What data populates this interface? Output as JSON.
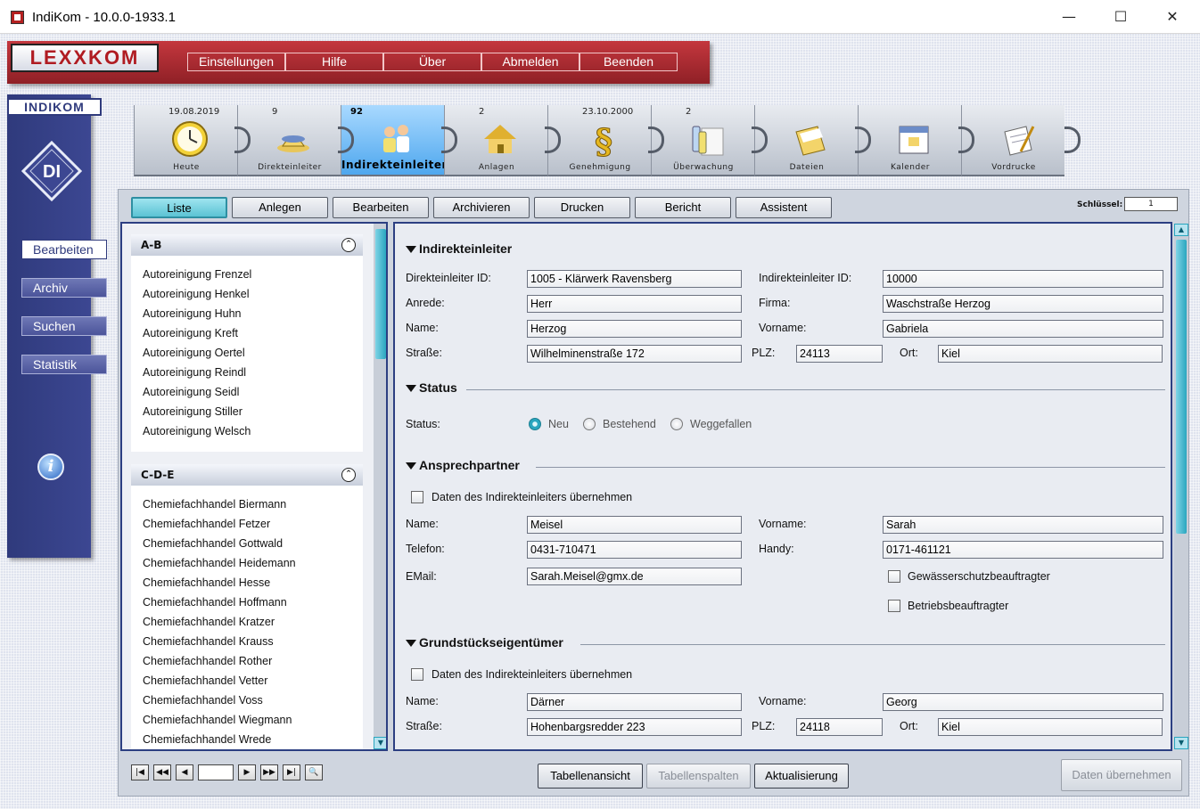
{
  "window": {
    "title": "IndiKom  -  10.0.0-1933.1",
    "minimize": "—",
    "maximize": "☐",
    "close": "✕"
  },
  "banner": {
    "logo": "LEXXKOM",
    "menu": [
      "Einstellungen",
      "Hilfe",
      "Über",
      "Abmelden",
      "Beenden"
    ]
  },
  "sidebar": {
    "logo": "INDIKOM",
    "monogram": "DI",
    "items": [
      "Bearbeiten",
      "Archiv",
      "Suchen",
      "Statistik"
    ],
    "active": "Bearbeiten",
    "info_icon": "i"
  },
  "modules": [
    {
      "top": "19.08.2019",
      "label": "Heute",
      "icon": "clock-icon"
    },
    {
      "top": "9",
      "label": "Direkteinleiter",
      "icon": "hats-icon"
    },
    {
      "top": "92",
      "label": "Indirekteinleiter",
      "icon": "people-icon",
      "active": true
    },
    {
      "top": "2",
      "label": "Anlagen",
      "icon": "house-icon"
    },
    {
      "top": "23.10.2000",
      "label": "Genehmigung",
      "icon": "paragraph-icon"
    },
    {
      "top": "2",
      "label": "Überwachung",
      "icon": "bottles-icon"
    },
    {
      "top": "",
      "label": "Dateien",
      "icon": "folder-icon"
    },
    {
      "top": "",
      "label": "Kalender",
      "icon": "calendar-icon"
    },
    {
      "top": "",
      "label": "Vordrucke",
      "icon": "forms-icon"
    }
  ],
  "toolbar": {
    "buttons": [
      "Liste",
      "Anlegen",
      "Bearbeiten",
      "Archivieren",
      "Drucken",
      "Bericht",
      "Assistent"
    ],
    "active": "Liste",
    "key_label": "Schlüssel:",
    "key_value": "1"
  },
  "list": {
    "groups": [
      {
        "name": "A-B",
        "items": [
          "Autoreinigung Frenzel",
          "Autoreinigung Henkel",
          "Autoreinigung Huhn",
          "Autoreinigung Kreft",
          "Autoreinigung Oertel",
          "Autoreinigung Reindl",
          "Autoreinigung Seidl",
          "Autoreinigung Stiller",
          "Autoreinigung Welsch"
        ]
      },
      {
        "name": "C-D-E",
        "items": [
          "Chemiefachhandel Biermann",
          "Chemiefachhandel Fetzer",
          "Chemiefachhandel Gottwald",
          "Chemiefachhandel Heidemann",
          "Chemiefachhandel Hesse",
          "Chemiefachhandel Hoffmann",
          "Chemiefachhandel Kratzer",
          "Chemiefachhandel Krauss",
          "Chemiefachhandel Rother",
          "Chemiefachhandel Vetter",
          "Chemiefachhandel Voss",
          "Chemiefachhandel Wiegmann",
          "Chemiefachhandel Wrede"
        ]
      }
    ],
    "collapse_icon": "⌃"
  },
  "pager": {
    "page_value": "",
    "search_icon": "🔍"
  },
  "bottom_buttons": {
    "table_view": "Tabellenansicht",
    "table_columns": "Tabellenspalten",
    "refresh": "Aktualisierung",
    "apply": "Daten übernehmen"
  },
  "form": {
    "indirekteinleiter": {
      "title": "Indirekteinleiter",
      "direkt_id_label": "Direkteinleiter ID:",
      "direkt_id": "1005 - Klärwerk Ravensberg",
      "indirekt_id_label": "Indirekteinleiter ID:",
      "indirekt_id": "10000",
      "anrede_label": "Anrede:",
      "anrede": "Herr",
      "firma_label": "Firma:",
      "firma": "Waschstraße Herzog",
      "name_label": "Name:",
      "name": "Herzog",
      "vorname_label": "Vorname:",
      "vorname": "Gabriela",
      "strasse_label": "Straße:",
      "strasse": "Wilhelminenstraße 172",
      "plz_label": "PLZ:",
      "plz": "24113",
      "ort_label": "Ort:",
      "ort": "Kiel"
    },
    "status": {
      "title": "Status",
      "label": "Status:",
      "options": [
        "Neu",
        "Bestehend",
        "Weggefallen"
      ],
      "selected": "Neu"
    },
    "ansprechpartner": {
      "title": "Ansprechpartner",
      "copy_label": "Daten des Indirekteinleiters übernehmen",
      "name_label": "Name:",
      "name": "Meisel",
      "vorname_label": "Vorname:",
      "vorname": "Sarah",
      "telefon_label": "Telefon:",
      "telefon": "0431-710471",
      "handy_label": "Handy:",
      "handy": "0171-461121",
      "email_label": "EMail:",
      "email": "Sarah.Meisel@gmx.de",
      "gewaesser_label": "Gewässerschutzbeauftragter",
      "betrieb_label": "Betriebsbeauftragter"
    },
    "eigentuemer": {
      "title": "Grundstückseigentümer",
      "copy_label": "Daten des Indirekteinleiters übernehmen",
      "name_label": "Name:",
      "name": "Därner",
      "vorname_label": "Vorname:",
      "vorname": "Georg",
      "strasse_label": "Straße:",
      "strasse": "Hohenbargsredder 223",
      "plz_label": "PLZ:",
      "plz": "24118",
      "ort_label": "Ort:",
      "ort": "Kiel"
    }
  }
}
